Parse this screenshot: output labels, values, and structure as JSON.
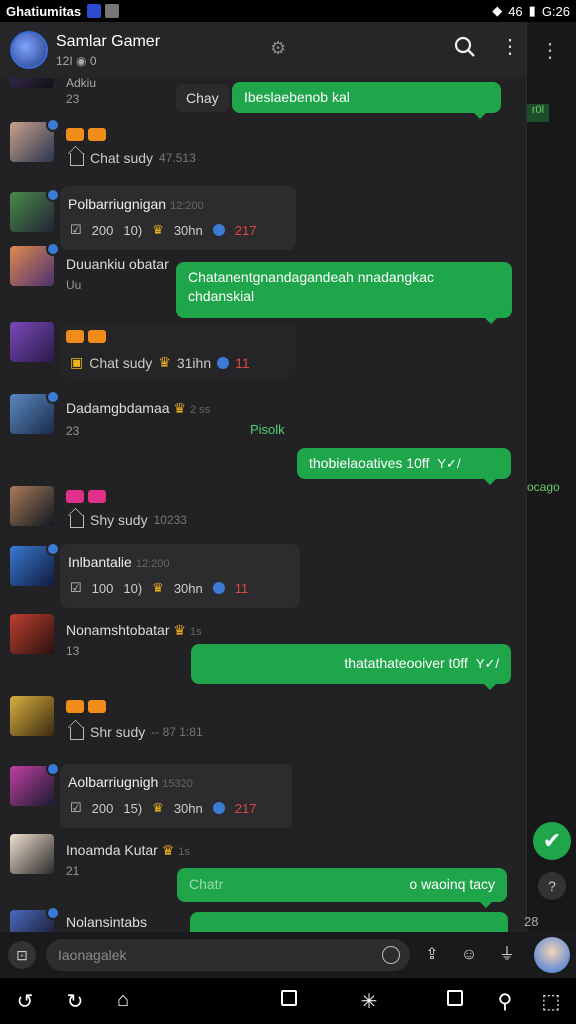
{
  "status_bar": {
    "app_name": "Ghatiumitas",
    "time": "G:26",
    "network": "46"
  },
  "header": {
    "title": "Samlar Gamer",
    "subtitle": "12I ◉ 0"
  },
  "messages": [
    {
      "name": "Adkiu",
      "sub": "23",
      "reply": "Chay",
      "bubble": "Ibeslaebenob kal"
    },
    {
      "status": "Chat sudy",
      "ts": "47.513"
    },
    {
      "card_name": "Polbarriugnigan",
      "card_ts": "12:200",
      "stats": {
        "a": "200",
        "b": "10)",
        "c": "30hn",
        "d": "217"
      }
    },
    {
      "name": "Duuankiu obatar",
      "sub": "Uu",
      "bubble": "Chatanentgnandagandeah nnadangkac chdanskial"
    },
    {
      "status": "Chat sudy",
      "crown_val": "31ihn",
      "count": "11"
    },
    {
      "name": "Dadamgbdamaa",
      "name_ts": "2 ss",
      "sub": "23",
      "green": "Pisolk",
      "bubble": "thobielaoatives 10ff",
      "ticks": "Y✓/"
    },
    {
      "status": "Shy sudy",
      "ts": "10233"
    },
    {
      "card_name": "Inlbantalie",
      "card_ts": "12:200",
      "stats": {
        "a": "100",
        "b": "10)",
        "c": "30hn",
        "d": "11"
      }
    },
    {
      "name": "Nonamshtobatar",
      "name_ts": "1s",
      "sub": "13",
      "bubble": "thatathateooiver t0ff",
      "ticks": "Y✓/"
    },
    {
      "status": "Shr sudy",
      "ts": "-- 87 1:81"
    },
    {
      "card_name": "Aolbarriugnigh",
      "card_ts": "15320",
      "stats": {
        "a": "200",
        "b": "15)",
        "c": "30hn",
        "d": "217"
      }
    },
    {
      "name": "Inoamda Kutar",
      "name_ts": "1s",
      "sub": "21",
      "bubble_left": "Chatr",
      "bubble": "o waoinq tacy"
    },
    {
      "name": "Nolansintabs"
    }
  ],
  "right_panel": {
    "chip": "r0l",
    "text": "ocago",
    "count": "28"
  },
  "composer": {
    "placeholder": "Iaonagalek"
  },
  "icons": [
    "search-icon",
    "more-icon",
    "gear-icon",
    "timer-icon",
    "upload-icon",
    "emoji-icon",
    "mic-icon",
    "check-icon",
    "back-icon",
    "home-icon"
  ],
  "colors": {
    "bubble": "#1fa64a",
    "background": "#222224",
    "accent": "#3a7bd5"
  }
}
